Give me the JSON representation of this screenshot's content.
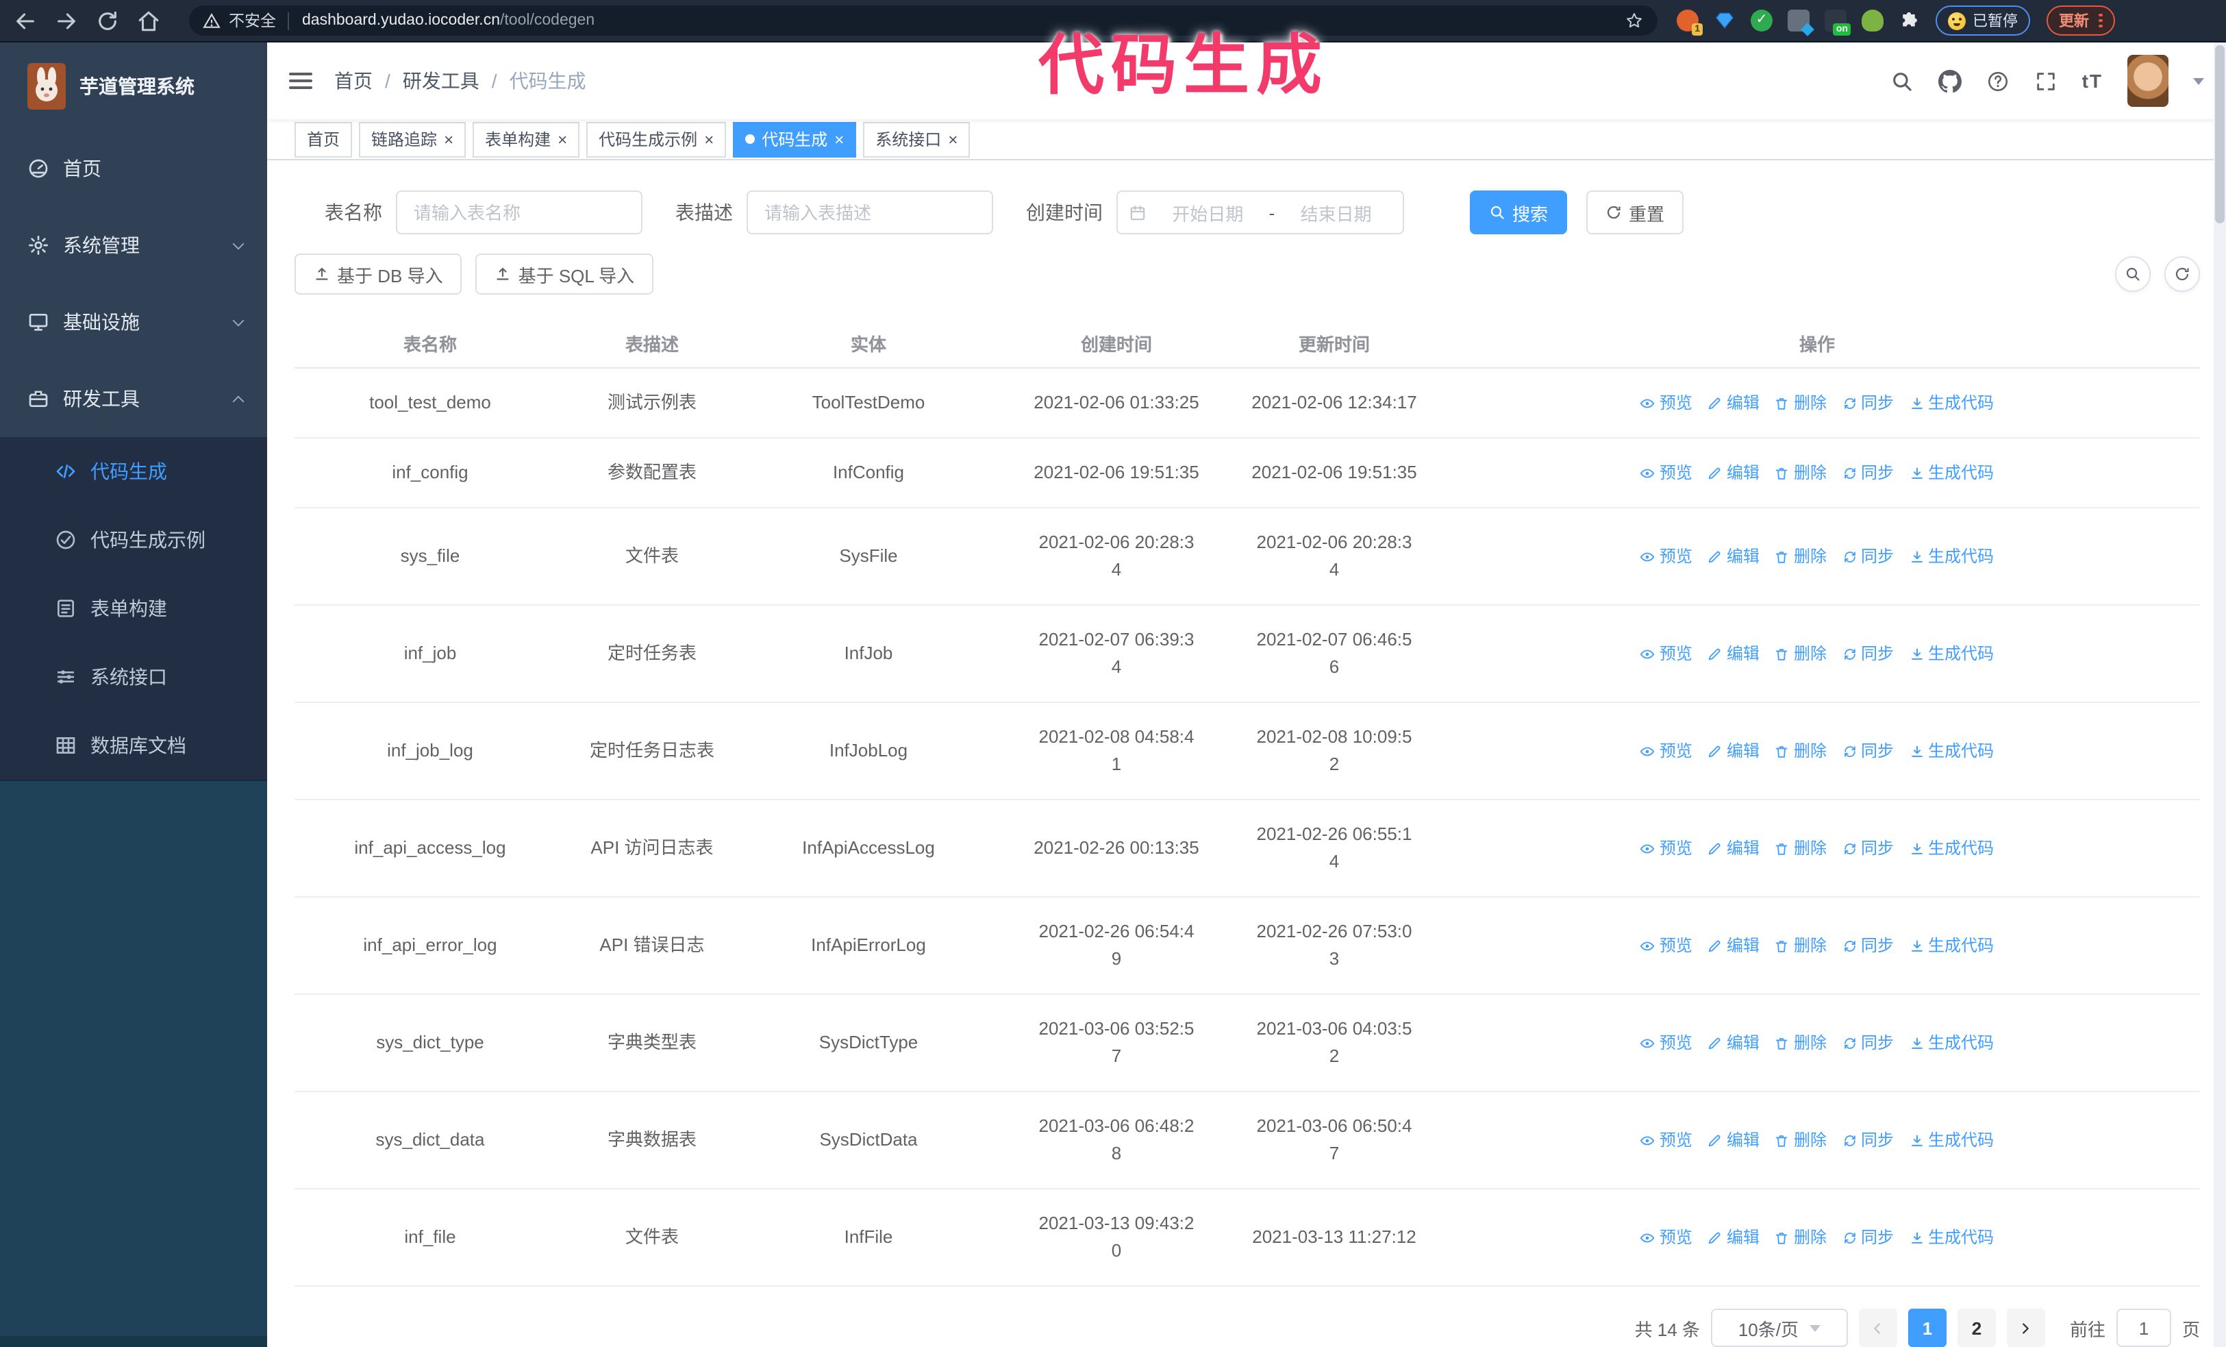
{
  "colors": {
    "primary": "#409EFF",
    "sidebar_bg": "#304156",
    "submenu_bg": "#222e44",
    "annotation": "#f23a6b",
    "update_badge": "#e4593b",
    "paused_badge": "#4e8ef7"
  },
  "annotation": {
    "text": "代码生成"
  },
  "browser": {
    "security_label": "不安全",
    "url_host": "dashboard.yudao.iocoder.cn",
    "url_path": "/tool/codegen",
    "ext_badge_count": "1",
    "ext_on_badge": "on",
    "paused_label": "已暂停",
    "update_label": "更新"
  },
  "sidebar": {
    "title": "芋道管理系统",
    "items": [
      {
        "label": "首页",
        "icon": "#i-dash",
        "mod": "no-chev"
      },
      {
        "label": "系统管理",
        "icon": "#i-gear"
      },
      {
        "label": "基础设施",
        "icon": "#i-monitor"
      },
      {
        "label": "研发工具",
        "icon": "#i-tool",
        "mod": "open"
      }
    ],
    "sub_items": [
      {
        "label": "代码生成",
        "icon": "#i-code",
        "mod": "active"
      },
      {
        "label": "代码生成示例",
        "icon": "#i-badge"
      },
      {
        "label": "表单构建",
        "icon": "#i-form"
      },
      {
        "label": "系统接口",
        "icon": "#i-sliders"
      },
      {
        "label": "数据库文档",
        "icon": "#i-grid"
      }
    ]
  },
  "header": {
    "breadcrumb": [
      {
        "label": "首页"
      },
      {
        "label": "研发工具"
      },
      {
        "label": "代码生成",
        "mod": "muted"
      }
    ]
  },
  "tabs": [
    {
      "label": "首页",
      "mod": "no-close"
    },
    {
      "label": "链路追踪"
    },
    {
      "label": "表单构建"
    },
    {
      "label": "代码生成示例"
    },
    {
      "label": "代码生成",
      "mod": "active"
    },
    {
      "label": "系统接口"
    }
  ],
  "filters": {
    "name_label": "表名称",
    "name_placeholder": "请输入表名称",
    "desc_label": "表描述",
    "desc_placeholder": "请输入表描述",
    "time_label": "创建时间",
    "start_placeholder": "开始日期",
    "range_separator": "-",
    "end_placeholder": "结束日期",
    "search_label": "搜索",
    "reset_label": "重置"
  },
  "toolbar": {
    "import_db_label": "基于 DB 导入",
    "import_sql_label": "基于 SQL 导入"
  },
  "table": {
    "columns": [
      "表名称",
      "表描述",
      "实体",
      "创建时间",
      "更新时间",
      "操作"
    ],
    "op_labels": [
      "预览",
      "编辑",
      "删除",
      "同步",
      "生成代码"
    ],
    "rows": [
      {
        "name": "tool_test_demo",
        "desc": "测试示例表",
        "entity": "ToolTestDemo",
        "ctime": "2021-02-06 01:33:25",
        "utime": "2021-02-06 12:34:17"
      },
      {
        "name": "inf_config",
        "desc": "参数配置表",
        "entity": "InfConfig",
        "ctime": "2021-02-06 19:51:35",
        "utime": "2021-02-06 19:51:35"
      },
      {
        "name": "sys_file",
        "desc": "文件表",
        "entity": "SysFile",
        "ctime": "2021-02-06 20:28:3\n4",
        "utime": "2021-02-06 20:28:3\n4"
      },
      {
        "name": "inf_job",
        "desc": "定时任务表",
        "entity": "InfJob",
        "ctime": "2021-02-07 06:39:3\n4",
        "utime": "2021-02-07 06:46:5\n6"
      },
      {
        "name": "inf_job_log",
        "desc": "定时任务日志表",
        "entity": "InfJobLog",
        "ctime": "2021-02-08 04:58:4\n1",
        "utime": "2021-02-08 10:09:5\n2"
      },
      {
        "name": "inf_api_access_log",
        "desc": "API 访问日志表",
        "entity": "InfApiAccessLog",
        "ctime": "2021-02-26 00:13:35",
        "utime": "2021-02-26 06:55:1\n4"
      },
      {
        "name": "inf_api_error_log",
        "desc": "API 错误日志",
        "entity": "InfApiErrorLog",
        "ctime": "2021-02-26 06:54:4\n9",
        "utime": "2021-02-26 07:53:0\n3"
      },
      {
        "name": "sys_dict_type",
        "desc": "字典类型表",
        "entity": "SysDictType",
        "ctime": "2021-03-06 03:52:5\n7",
        "utime": "2021-03-06 04:03:5\n2"
      },
      {
        "name": "sys_dict_data",
        "desc": "字典数据表",
        "entity": "SysDictData",
        "ctime": "2021-03-06 06:48:2\n8",
        "utime": "2021-03-06 06:50:4\n7"
      },
      {
        "name": "inf_file",
        "desc": "文件表",
        "entity": "InfFile",
        "ctime": "2021-03-13 09:43:2\n0",
        "utime": "2021-03-13 11:27:12"
      }
    ]
  },
  "pagination": {
    "total_label": "共 14 条",
    "page_size_label": "10条/页",
    "pages": [
      {
        "label": "1",
        "mod": "active"
      },
      {
        "label": "2"
      }
    ],
    "goto_label": "前往",
    "goto_value": "1",
    "page_suffix": "页"
  }
}
